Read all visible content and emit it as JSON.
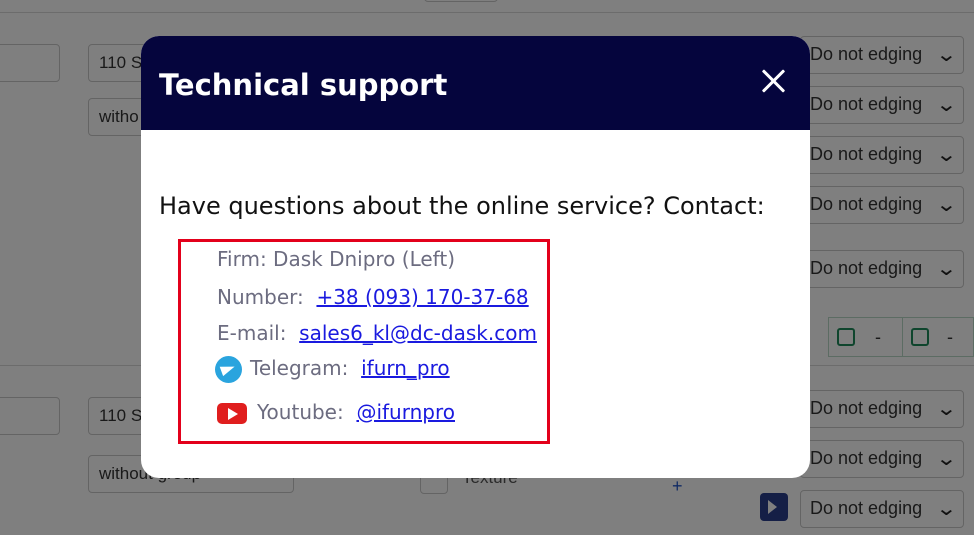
{
  "background": {
    "edging_select_value": "Do not edging",
    "thickness_value": "110 S",
    "group_value": "witho",
    "group_value_full": "without group",
    "texture_label": "Texture",
    "strip_dash": "-"
  },
  "modal": {
    "title": "Technical support",
    "question": "Have questions about the online service? Contact:",
    "firm": "Firm: Dask Dnipro (Left)",
    "number_label": "Number:",
    "number_value": "+38 (093) 170-37-68",
    "email_label": "E-mail:",
    "email_value": "sales6_kl@dc-dask.com",
    "telegram_label": "Telegram:",
    "telegram_value": "ifurn_pro",
    "youtube_label": "Youtube:",
    "youtube_value": "@ifurnpro",
    "icons": [
      "close-icon",
      "telegram-icon",
      "youtube-icon"
    ],
    "colors": {
      "header": "#05053d",
      "highlight_border": "#e3001b",
      "link": "#1a1adf"
    }
  }
}
